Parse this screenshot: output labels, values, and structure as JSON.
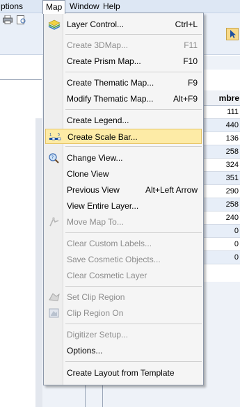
{
  "menubar": {
    "items": [
      {
        "label": "ptions"
      },
      {
        "label": "Map"
      },
      {
        "label": "Window"
      },
      {
        "label": "Help"
      }
    ]
  },
  "browser": {
    "header": "mbre",
    "cells": [
      "111",
      "440",
      "136",
      "258",
      "324",
      "351",
      "290",
      "258",
      "240",
      "0",
      "0",
      "0"
    ]
  },
  "menu": {
    "items": [
      {
        "label": "Layer Control...",
        "shortcut": "Ctrl+L",
        "enabled": true,
        "icon": "layer-control-icon"
      },
      {
        "label": "Create 3DMap...",
        "shortcut": "F11",
        "enabled": false
      },
      {
        "label": "Create Prism Map...",
        "shortcut": "F10",
        "enabled": true
      },
      {
        "label": "Create Thematic Map...",
        "shortcut": "F9",
        "enabled": true
      },
      {
        "label": "Modify Thematic Map...",
        "shortcut": "Alt+F9",
        "enabled": true
      },
      {
        "label": "Create Legend...",
        "shortcut": "",
        "enabled": true
      },
      {
        "label": "Create Scale Bar...",
        "shortcut": "",
        "enabled": true,
        "icon": "scale-bar-icon",
        "highlighted": true
      },
      {
        "label": "Change View...",
        "shortcut": "",
        "enabled": true,
        "icon": "change-view-icon"
      },
      {
        "label": "Clone View",
        "shortcut": "",
        "enabled": true
      },
      {
        "label": "Previous View",
        "shortcut": "Alt+Left Arrow",
        "enabled": true
      },
      {
        "label": "View Entire Layer...",
        "shortcut": "",
        "enabled": true
      },
      {
        "label": "Move Map To...",
        "shortcut": "",
        "enabled": false,
        "icon": "move-map-icon"
      },
      {
        "label": "Clear Custom Labels...",
        "shortcut": "",
        "enabled": false
      },
      {
        "label": "Save Cosmetic Objects...",
        "shortcut": "",
        "enabled": false
      },
      {
        "label": "Clear Cosmetic Layer",
        "shortcut": "",
        "enabled": false
      },
      {
        "label": "Set Clip Region",
        "shortcut": "",
        "enabled": false,
        "icon": "set-clip-region-icon"
      },
      {
        "label": "Clip Region On",
        "shortcut": "",
        "enabled": false,
        "icon": "clip-region-icon"
      },
      {
        "label": "Digitizer Setup...",
        "shortcut": "",
        "enabled": false
      },
      {
        "label": "Options...",
        "shortcut": "",
        "enabled": true
      },
      {
        "label": "Create Layout from Template",
        "shortcut": "",
        "enabled": true
      }
    ]
  },
  "colors": {
    "menu_background": "#f5f5f5",
    "highlight": "#fdeba6",
    "highlight_border": "#e5c365",
    "disabled_text": "#8d8d8d",
    "menubar": "#dde7f4"
  }
}
